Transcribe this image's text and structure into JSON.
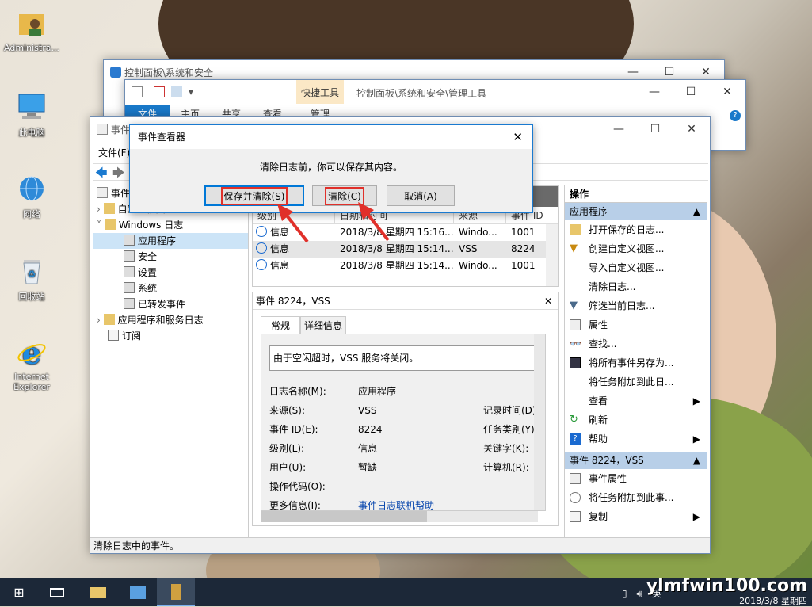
{
  "desktop": {
    "icons": [
      {
        "label": "Administra..."
      },
      {
        "label": "此电脑"
      },
      {
        "label": "网络"
      },
      {
        "label": "回收站"
      },
      {
        "label": "Internet Explorer"
      }
    ]
  },
  "cp_window": {
    "title": "控制面板\\系统和安全"
  },
  "admin_window": {
    "path": "控制面板\\系统和安全\\管理工具",
    "tabs": [
      "文件",
      "主页",
      "共享",
      "查看"
    ],
    "context_tab": "快捷工具",
    "context_sub": "管理"
  },
  "ev_window": {
    "title": "事件",
    "menu": [
      "文件(F)"
    ],
    "tree": {
      "root": "事件",
      "custom_views": "自定义视图",
      "windows_logs": "Windows 日志",
      "logs": [
        "应用程序",
        "安全",
        "设置",
        "系统",
        "已转发事件"
      ],
      "app_service": "应用程序和服务日志",
      "subscriptions": "订阅"
    },
    "columns": [
      "级别",
      "日期和时间",
      "来源",
      "事件 ID"
    ],
    "rows": [
      {
        "level": "信息",
        "date": "2018/3/8 星期四 15:16...",
        "source": "Windo...",
        "id": "1001"
      },
      {
        "level": "信息",
        "date": "2018/3/8 星期四 15:14...",
        "source": "VSS",
        "id": "8224"
      },
      {
        "level": "信息",
        "date": "2018/3/8 星期四 15:14...",
        "source": "Windo...",
        "id": "1001"
      }
    ],
    "detail": {
      "header": "事件 8224，VSS",
      "tabs": [
        "常规",
        "详细信息"
      ],
      "message": "由于空闲超时，VSS 服务将关闭。",
      "labels": [
        "日志名称(M):",
        "来源(S):",
        "事件 ID(E):",
        "级别(L):",
        "用户(U):",
        "操作代码(O):",
        "更多信息(I):"
      ],
      "values": [
        "应用程序",
        "VSS",
        "8224",
        "信息",
        "暂缺",
        "",
        "事件日志联机帮助"
      ],
      "right_labels": [
        "记录时间(D):",
        "任务类别(Y):",
        "关键字(K):",
        "计算机(R):"
      ]
    },
    "actions": {
      "header": "操作",
      "sec1": "应用程序",
      "items1": [
        "打开保存的日志...",
        "创建自定义视图...",
        "导入自定义视图...",
        "清除日志...",
        "筛选当前日志...",
        "属性",
        "查找...",
        "将所有事件另存为...",
        "将任务附加到此日...",
        "查看",
        "刷新",
        "帮助"
      ],
      "sec2": "事件 8224，VSS",
      "items2": [
        "事件属性",
        "将任务附加到此事...",
        "复制"
      ]
    },
    "status": "清除日志中的事件。"
  },
  "dialog": {
    "title": "事件查看器",
    "message": "清除日志前，你可以保存其内容。",
    "buttons": {
      "save_clear": "保存并清除(S)",
      "clear": "清除(C)",
      "cancel": "取消(A)"
    }
  },
  "taskbar": {
    "time": "2018/3/8 星期四",
    "ime": "英",
    "watermark": "ylmfwin100.com"
  },
  "colors": {
    "accent": "#0078d7",
    "highlight": "#e0302a"
  }
}
